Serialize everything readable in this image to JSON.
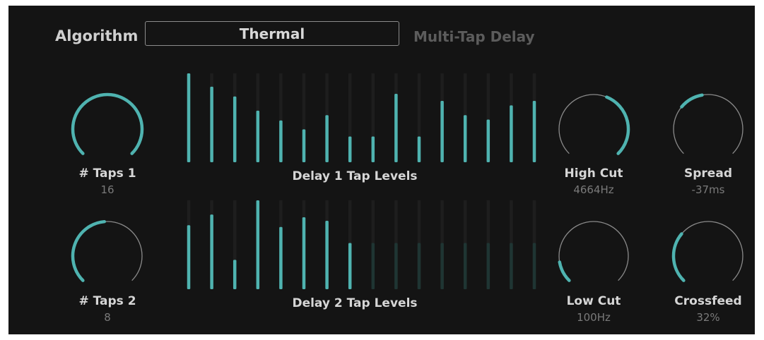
{
  "header": {
    "algorithm_label": "Algorithm",
    "algorithm_value": "Thermal",
    "algorithm_description": "Multi-Tap Delay"
  },
  "colors": {
    "accent": "#4fb3b0",
    "accent_dim": "#1f3533",
    "track": "#8a8a8a",
    "slot": "#1e1e1e",
    "background": "#141414"
  },
  "knobs": {
    "taps1": {
      "label": "# Taps 1",
      "value": "16",
      "level": 1.0
    },
    "taps2": {
      "label": "# Taps 2",
      "value": "8",
      "level": 0.5
    },
    "high_cut": {
      "label": "High Cut",
      "value": "4664Hz",
      "level": 0.88
    },
    "low_cut": {
      "label": "Low Cut",
      "value": "100Hz",
      "level": 0.12
    },
    "spread": {
      "label": "Spread",
      "value": "-37ms",
      "level": 0.32
    },
    "crossfeed": {
      "label": "Crossfeed",
      "value": "32%",
      "level": 0.32
    }
  },
  "delay1": {
    "caption": "Delay 1 Tap Levels",
    "active_taps": 16,
    "levels": [
      1.0,
      0.85,
      0.74,
      0.58,
      0.47,
      0.37,
      0.53,
      0.29,
      0.29,
      0.77,
      0.29,
      0.69,
      0.53,
      0.48,
      0.64,
      0.69
    ]
  },
  "delay2": {
    "caption": "Delay 2 Tap Levels",
    "active_taps": 8,
    "levels": [
      0.72,
      0.84,
      0.33,
      1.0,
      0.7,
      0.81,
      0.77,
      0.52,
      0.52,
      0.52,
      0.52,
      0.52,
      0.52,
      0.52,
      0.52,
      0.52
    ]
  }
}
